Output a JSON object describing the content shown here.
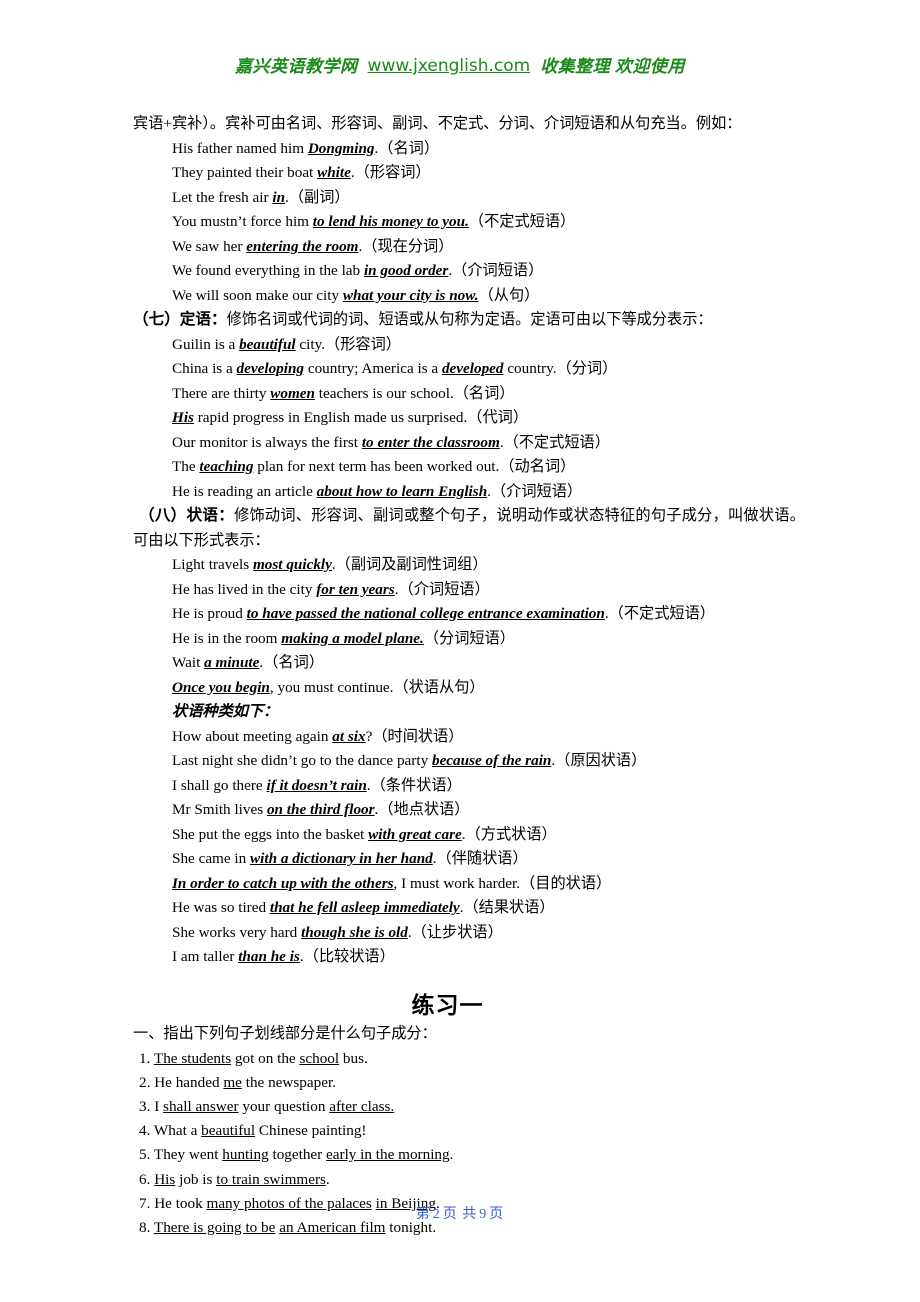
{
  "header": {
    "site_name": "嘉兴英语教学网",
    "url": "www.jxenglish.com",
    "tagline": "收集整理 欢迎使用",
    "color": "#1a8a1a"
  },
  "intro": {
    "text": "宾语+宾补）。宾补可由名词、形容词、副词、不定式、分词、介词短语和从句充当。例如："
  },
  "object_complement_examples": [
    {
      "pre": "His father named him ",
      "em": "Dongming",
      "post": ".（名词）"
    },
    {
      "pre": "They painted their boat ",
      "em": "white",
      "post": ".（形容词）"
    },
    {
      "pre": "Let the fresh air ",
      "em": "in",
      "post": ".（副词）"
    },
    {
      "pre": "You mustn’t force him ",
      "em": "to lend his money to you.",
      "post": "（不定式短语）"
    },
    {
      "pre": "We saw her ",
      "em": "entering the room",
      "post": ".（现在分词）"
    },
    {
      "pre": "We found everything in the lab ",
      "em": "in good order",
      "post": ".（介词短语）"
    },
    {
      "pre": "We will soon make our city ",
      "em": "what your city is now.",
      "post": "（从句）"
    }
  ],
  "section_attributive": {
    "lead": "（七）定语：",
    "body": "修饰名词或代词的词、短语或从句称为定语。定语可由以下等成分表示：",
    "examples": [
      {
        "pre": "Guilin is a ",
        "em": "beautiful",
        "post": " city.（形容词）"
      },
      {
        "pre": "China is a ",
        "em": "developing",
        "mid": " country; America is a ",
        "em2": "developed",
        "post": " country.（分词）"
      },
      {
        "pre": "There are thirty ",
        "em": "women",
        "post": " teachers is our school.（名词）"
      },
      {
        "pre": "",
        "em": "His",
        "post": " rapid progress in English made us surprised.（代词）"
      },
      {
        "pre": "Our monitor is always the first ",
        "em": "to enter the classroom",
        "post": ".（不定式短语）"
      },
      {
        "pre": "The ",
        "em": "teaching",
        "post": " plan for next term has been worked out.（动名词）"
      },
      {
        "pre": "He is reading an article ",
        "em": "about how to learn English",
        "post": ".（介词短语）"
      }
    ]
  },
  "section_adverbial": {
    "lead": "（八）状语：",
    "body": "修饰动词、形容词、副词或整个句子，说明动作或状态特征的句子成分，叫做状语。可由以下形式表示：",
    "examples": [
      {
        "pre": "Light travels ",
        "em": "most quickly",
        "post": ".（副词及副词性词组）"
      },
      {
        "pre": "He has lived in the city ",
        "em": "for ten years",
        "post": ".（介词短语）"
      },
      {
        "pre": "He is proud ",
        "em": "to have passed the national college entrance examination",
        "post": ".（不定式短语）"
      },
      {
        "pre": "He is in the room ",
        "em": "making a model plane.",
        "post": "（分词短语）"
      },
      {
        "pre": "Wait ",
        "em": "a minute",
        "post": ".（名词）"
      },
      {
        "pre": "",
        "em": "Once you begin",
        "post": ", you must continue.（状语从句）"
      }
    ],
    "types_heading": "状语种类如下：",
    "type_examples": [
      {
        "pre": "How about meeting again ",
        "em": "at six",
        "post": "?（时间状语）"
      },
      {
        "pre": "Last night she didn’t go to the dance party ",
        "em": "because of the rain",
        "post": ".（原因状语）"
      },
      {
        "pre": "I shall go there ",
        "em": "if it doesn’t rain",
        "post": ".（条件状语）"
      },
      {
        "pre": "Mr Smith lives ",
        "em": "on the third floor",
        "post": ".（地点状语）"
      },
      {
        "pre": "She put the eggs into the basket ",
        "em": "with great care",
        "post": ".（方式状语）"
      },
      {
        "pre": "She came in ",
        "em": "with a dictionary in her hand",
        "post": ".（伴随状语）"
      },
      {
        "pre": "",
        "em": "In order to catch up with the others",
        "post": ", I must work harder.（目的状语）"
      },
      {
        "pre": "He was so tired ",
        "em": "that he fell asleep immediately",
        "post": ".（结果状语）"
      },
      {
        "pre": "She works very hard ",
        "em": "though she is old",
        "post": ".（让步状语）"
      },
      {
        "pre": "I am taller ",
        "em": "than he is",
        "post": ".（比较状语）"
      }
    ]
  },
  "exercise": {
    "title": "练习一",
    "prompt": "一、指出下列句子划线部分是什么句子成分：",
    "items": [
      {
        "num": "1.",
        "parts": [
          {
            "t": " ",
            "u": false
          },
          {
            "t": "The students",
            "u": true
          },
          {
            "t": " got on the ",
            "u": false
          },
          {
            "t": "school",
            "u": true
          },
          {
            "t": " bus.",
            "u": false
          }
        ]
      },
      {
        "num": "2.",
        "parts": [
          {
            "t": " He handed ",
            "u": false
          },
          {
            "t": "me",
            "u": true
          },
          {
            "t": " the newspaper.",
            "u": false
          }
        ]
      },
      {
        "num": "3.",
        "parts": [
          {
            "t": " I ",
            "u": false
          },
          {
            "t": "shall answer",
            "u": true
          },
          {
            "t": " your question ",
            "u": false
          },
          {
            "t": "after class.",
            "u": true
          }
        ]
      },
      {
        "num": "4.",
        "parts": [
          {
            "t": " What a ",
            "u": false
          },
          {
            "t": "beautiful",
            "u": true
          },
          {
            "t": " Chinese painting!",
            "u": false
          }
        ]
      },
      {
        "num": "5.",
        "parts": [
          {
            "t": " They went ",
            "u": false
          },
          {
            "t": "hunting",
            "u": true
          },
          {
            "t": " together ",
            "u": false
          },
          {
            "t": "early in the morning",
            "u": true
          },
          {
            "t": ".",
            "u": false
          }
        ]
      },
      {
        "num": "6.",
        "parts": [
          {
            "t": " ",
            "u": false
          },
          {
            "t": "His",
            "u": true
          },
          {
            "t": " job is ",
            "u": false
          },
          {
            "t": "to train swimmers",
            "u": true
          },
          {
            "t": ".",
            "u": false
          }
        ]
      },
      {
        "num": "7.",
        "parts": [
          {
            "t": " He took ",
            "u": false
          },
          {
            "t": "many photos of the palaces",
            "u": true
          },
          {
            "t": " ",
            "u": false
          },
          {
            "t": "in Beijing",
            "u": true
          },
          {
            "t": ".",
            "u": false
          }
        ]
      },
      {
        "num": "8.",
        "parts": [
          {
            "t": " ",
            "u": false
          },
          {
            "t": "There is going to be",
            "u": true
          },
          {
            "t": " ",
            "u": false
          },
          {
            "t": "an American film",
            "u": true
          },
          {
            "t": " tonight.",
            "u": false
          }
        ]
      }
    ]
  },
  "footer": {
    "prefix": "第",
    "page": "2",
    "mid": "页  共",
    "total": "9",
    "suffix": "页",
    "color": "#3a5fd0"
  }
}
